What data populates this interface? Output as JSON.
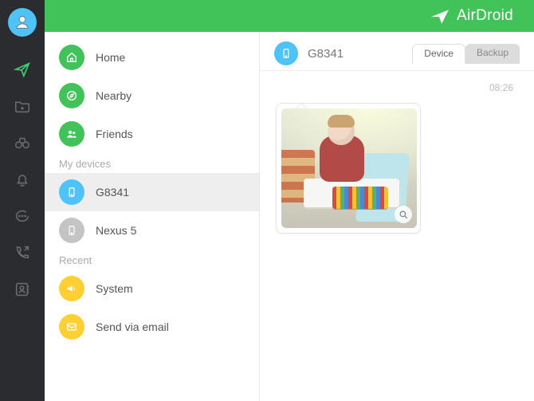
{
  "brand": {
    "name": "AirDroid"
  },
  "rail": {
    "items": [
      {
        "id": "avatar"
      },
      {
        "id": "send",
        "active": true
      },
      {
        "id": "files"
      },
      {
        "id": "discover"
      },
      {
        "id": "notifications"
      },
      {
        "id": "chat"
      },
      {
        "id": "calls"
      },
      {
        "id": "contacts"
      }
    ]
  },
  "list": {
    "top": [
      {
        "icon": "home",
        "label": "Home",
        "color": "green"
      },
      {
        "icon": "compass",
        "label": "Nearby",
        "color": "green"
      },
      {
        "icon": "friends",
        "label": "Friends",
        "color": "green"
      }
    ],
    "sections": [
      {
        "title": "My devices",
        "items": [
          {
            "icon": "phone",
            "label": "G8341",
            "color": "blue",
            "selected": true
          },
          {
            "icon": "phone",
            "label": "Nexus 5",
            "color": "gray"
          }
        ]
      },
      {
        "title": "Recent",
        "items": [
          {
            "icon": "speaker",
            "label": "System",
            "color": "yellow"
          },
          {
            "icon": "mail",
            "label": "Send via email",
            "color": "yellow"
          }
        ]
      }
    ]
  },
  "pane": {
    "device_name": "G8341",
    "tabs": [
      {
        "id": "device",
        "label": "Device",
        "active": true
      },
      {
        "id": "backup",
        "label": "Backup",
        "active": false
      }
    ],
    "messages": [
      {
        "time": "08:26",
        "type": "image",
        "alt": "child drawing at table"
      }
    ]
  }
}
